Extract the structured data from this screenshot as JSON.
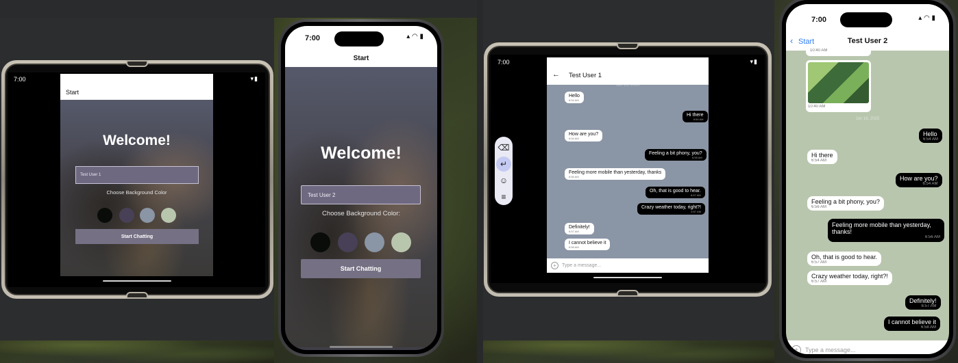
{
  "devices": {
    "fold1": {
      "status_time": "7:00",
      "nav_title": "Start",
      "welcome": "Welcome!",
      "name_value": "Test User 1",
      "choose_label": "Choose Background Color",
      "swatches": [
        "#090C08",
        "#474056",
        "#8A95A5",
        "#B9C6AE"
      ],
      "button_label": "Start Chatting"
    },
    "iphone1": {
      "status_time": "7:00",
      "nav_title": "Start",
      "welcome": "Welcome!",
      "name_value": "Test User 2",
      "choose_label": "Choose Background Color:",
      "swatches": [
        "#090C08",
        "#474056",
        "#8A95A5",
        "#B9C6AE"
      ],
      "button_label": "Start Chatting"
    },
    "fold2": {
      "status_time": "7:00",
      "header_title": "Test User 1",
      "back_icon": "arrow-left-icon",
      "date_separator": "Jan 16, 2025",
      "background": "#8A95A5",
      "messages": [
        {
          "dir": "in",
          "text": "Hello",
          "time": "6:54 AM"
        },
        {
          "dir": "out",
          "text": "Hi there",
          "time": "6:54 AM"
        },
        {
          "dir": "in",
          "text": "How are you?",
          "time": "6:54 AM"
        },
        {
          "dir": "out",
          "text": "Feeling a bit phony, you?",
          "time": "6:55 AM"
        },
        {
          "dir": "in",
          "text": "Feeling more mobile than yesterday, thanks",
          "time": "6:56 AM"
        },
        {
          "dir": "out",
          "text": "Oh, that is good to hear.",
          "time": "6:57 AM"
        },
        {
          "dir": "out",
          "text": "Crazy weather today, right?!",
          "time": "6:57 AM"
        },
        {
          "dir": "in",
          "text": "Definitely!",
          "time": "6:57 AM"
        },
        {
          "dir": "in",
          "text": "I cannot believe it",
          "time": "6:58 AM"
        }
      ],
      "composer_placeholder": "Type a message...",
      "keyboard_tools": [
        "backspace-icon",
        "enter-icon",
        "emoji-icon",
        "menu-icon"
      ]
    },
    "iphone2": {
      "status_time": "7:00",
      "back_label": "Start",
      "header_title": "Test User 2",
      "background": "#B9C6AE",
      "top_times": [
        "10:40 AM",
        "10:40 AM"
      ],
      "date_separator": "Jan 16, 2025",
      "messages": [
        {
          "dir": "out",
          "text": "Hello",
          "time": "6:54 AM"
        },
        {
          "dir": "in",
          "text": "Hi there",
          "time": "6:54 AM"
        },
        {
          "dir": "out",
          "text": "How are you?",
          "time": "6:54 AM"
        },
        {
          "dir": "in",
          "text": "Feeling a bit phony, you?",
          "time": "6:56 AM"
        },
        {
          "dir": "out",
          "text": "Feeling more mobile than yesterday, thanks!",
          "time": "6:56 AM"
        },
        {
          "dir": "in",
          "text": "Oh, that is good to hear.",
          "time": "6:57 AM"
        },
        {
          "dir": "in",
          "text": "Crazy weather today, right?!",
          "time": "6:57 AM"
        },
        {
          "dir": "out",
          "text": "Definitely!",
          "time": "6:57 AM"
        },
        {
          "dir": "out",
          "text": "I cannot believe it",
          "time": "6:58 AM"
        }
      ],
      "composer_placeholder": "Type a message..."
    }
  }
}
